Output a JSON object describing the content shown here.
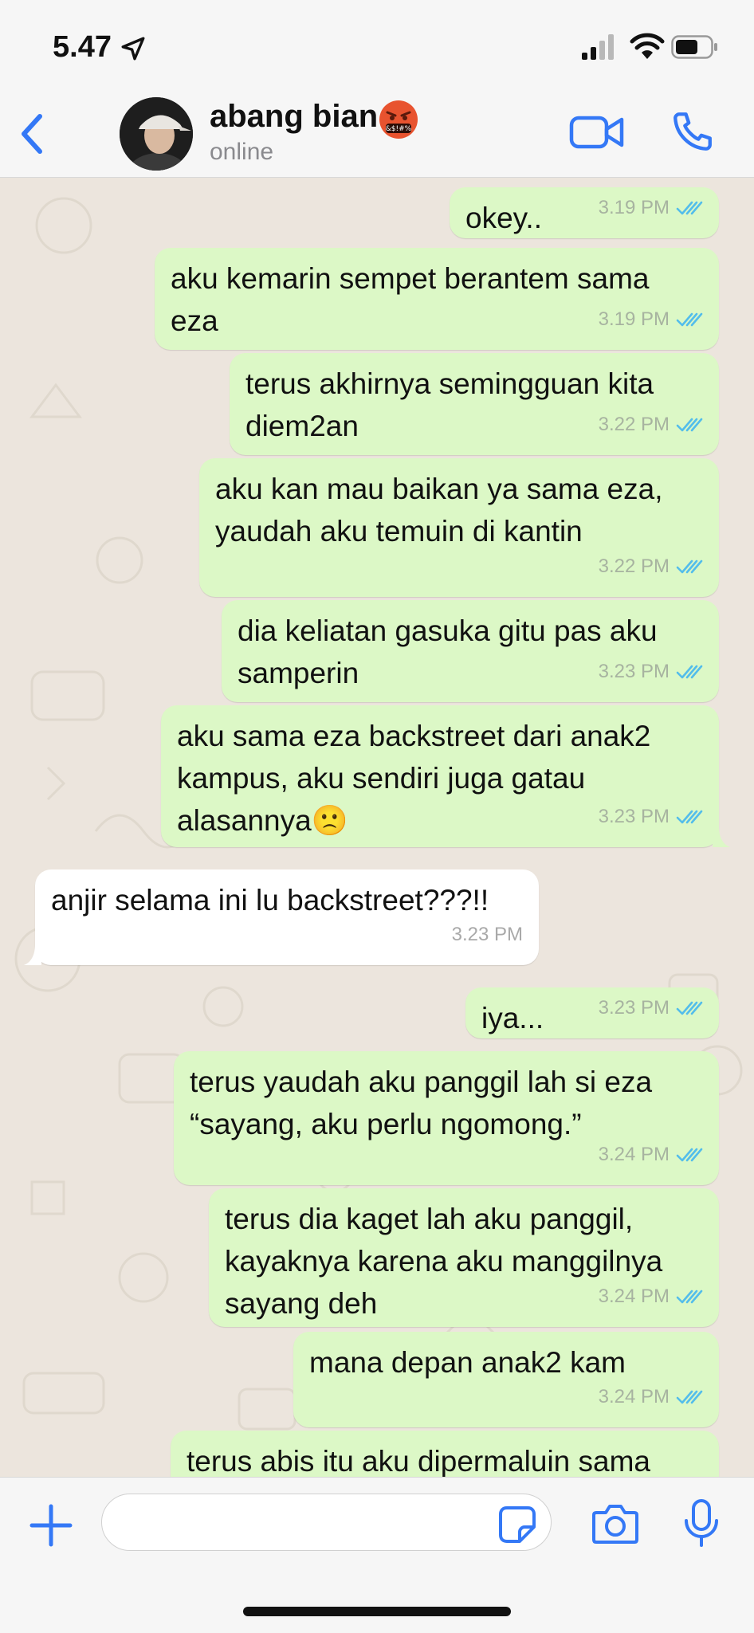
{
  "status_bar": {
    "time": "5.47"
  },
  "header": {
    "contact_name": "abang bian",
    "contact_status": "online"
  },
  "messages": [
    {
      "direction": "out",
      "lines": [
        "okey.."
      ],
      "time": "3.19 PM"
    },
    {
      "direction": "out",
      "lines": [
        "aku kemarin sempet berantem sama",
        "eza"
      ],
      "time": "3.19 PM"
    },
    {
      "direction": "out",
      "lines": [
        "terus akhirnya semingguan kita",
        "diem2an"
      ],
      "time": "3.22 PM"
    },
    {
      "direction": "out",
      "lines": [
        "aku kan mau baikan ya sama eza,",
        "yaudah aku temuin di kantin"
      ],
      "time": "3.22 PM"
    },
    {
      "direction": "out",
      "lines": [
        "dia keliatan gasuka gitu pas aku",
        "samperin"
      ],
      "time": "3.23 PM"
    },
    {
      "direction": "out",
      "lines": [
        "aku sama eza backstreet dari anak2",
        "kampus, aku sendiri juga gatau",
        "alasannya🙁"
      ],
      "time": "3.23 PM"
    },
    {
      "direction": "in",
      "lines": [
        "anjir selama ini lu backstreet???!!"
      ],
      "time": "3.23 PM"
    },
    {
      "direction": "out",
      "lines": [
        "iya..."
      ],
      "time": "3.23 PM"
    },
    {
      "direction": "out",
      "lines": [
        "terus yaudah aku panggil lah si eza",
        "“sayang, aku perlu ngomong.”"
      ],
      "time": "3.24 PM"
    },
    {
      "direction": "out",
      "lines": [
        "terus dia kaget lah aku panggil,",
        "kayaknya karena aku manggilnya",
        "sayang deh"
      ],
      "time": "3.24 PM"
    },
    {
      "direction": "out",
      "lines": [
        "mana depan anak2 kam"
      ],
      "time": "3.24 PM"
    },
    {
      "direction": "out",
      "lines": [
        "terus abis itu aku dipermaluin sama"
      ],
      "time": ""
    }
  ],
  "composer": {
    "input_value": ""
  },
  "colors": {
    "accent": "#3478f6",
    "outgoing_bubble": "#dcf8c6",
    "incoming_bubble": "#ffffff",
    "read_ticks": "#53bdeb"
  },
  "icons": [
    "location-arrow-icon",
    "signal-icon",
    "wifi-icon",
    "battery-icon",
    "back-chevron-icon",
    "angry-face-emoji",
    "video-camera-icon",
    "phone-icon",
    "double-check-icon",
    "scroll-down-icon",
    "plus-icon",
    "sticker-icon",
    "camera-icon",
    "microphone-icon"
  ]
}
